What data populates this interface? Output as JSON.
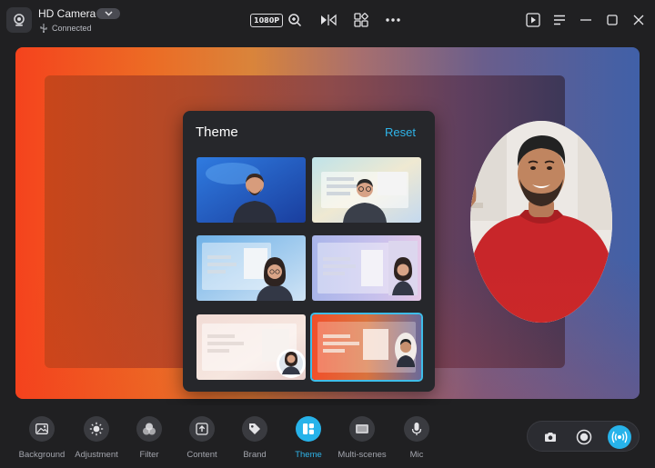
{
  "window": {
    "camera_name": "HD Camera",
    "connection_status": "Connected",
    "resolution": "1080P"
  },
  "icons": {
    "app": "webcam-icon",
    "dropdown": "chevron-down-icon",
    "usb": "usb-icon",
    "zoom": "zoom-in-icon",
    "mirror": "mirror-flip-icon",
    "widgets": "widgets-icon",
    "more": "more-icon",
    "play": "play-window-icon",
    "menu": "menu-icon",
    "minimize": "minimize-icon",
    "maximize": "maximize-icon",
    "close": "close-icon"
  },
  "theme_panel": {
    "title": "Theme",
    "reset_label": "Reset",
    "selected_index": 5,
    "accent_color": "#2fb4e9"
  },
  "bottom_nav": [
    {
      "label": "Background",
      "icon": "image-icon"
    },
    {
      "label": "Adjustment",
      "icon": "brightness-icon"
    },
    {
      "label": "Filter",
      "icon": "filter-circles-icon"
    },
    {
      "label": "Content",
      "icon": "upload-icon"
    },
    {
      "label": "Brand",
      "icon": "tag-icon"
    },
    {
      "label": "Theme",
      "icon": "theme-grid-icon"
    },
    {
      "label": "Multi-scenes",
      "icon": "scenes-icon"
    },
    {
      "label": "Mic",
      "icon": "microphone-icon"
    }
  ],
  "active_nav": "Theme",
  "record_controls": {
    "snapshot": "camera-icon",
    "record": "record-icon",
    "live": "live-broadcast-icon"
  }
}
